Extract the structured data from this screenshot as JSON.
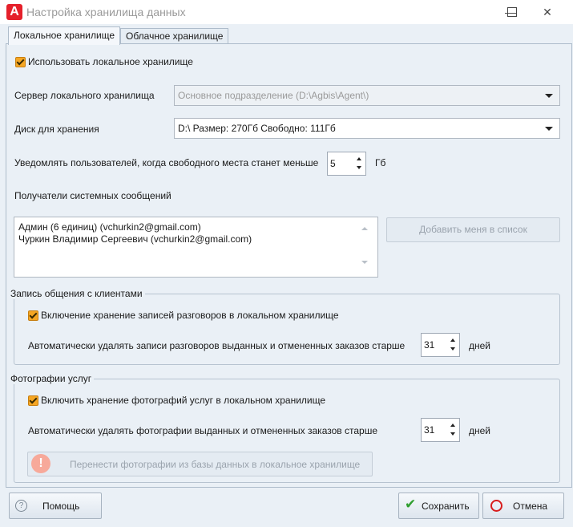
{
  "window": {
    "title": "Настройка хранилища данных",
    "logo_letter": "A",
    "minimize_symbol": "—",
    "maximize_symbol": "☐",
    "close_symbol": "✕"
  },
  "tabs": [
    {
      "label": "Локальное хранилище",
      "active": true
    },
    {
      "label": "Облачное хранилище",
      "active": false
    }
  ],
  "local": {
    "use_local_label": "Использовать локальное хранилище",
    "use_local_checked": true,
    "server_label": "Сервер локального хранилища",
    "server_value": "Основное подразделение (D:\\Agbis\\Agent\\)",
    "disk_label": "Диск для хранения",
    "disk_value": "D:\\ Размер: 270Гб Свободно: 111Гб",
    "notify_label": "Уведомлять пользователей, когда свободного места станет меньше",
    "notify_value": "5",
    "notify_unit": "Гб",
    "recipients_label": "Получатели системных сообщений",
    "recipients": [
      "Админ (6 единиц) (vchurkin2@gmail.com)",
      "Чуркин Владимир Сергеевич (vchurkin2@gmail.com)"
    ],
    "add_me_button": "Добавить меня в список"
  },
  "calls_group": {
    "title": "Запись общения с клиентами",
    "enable_label": "Включение хранение записей разговоров в локальном хранилище",
    "enable_checked": true,
    "delete_label": "Автоматически удалять записи разговоров выданных и отмененных заказов старше",
    "delete_value": "31",
    "delete_unit": "дней"
  },
  "photos_group": {
    "title": "Фотографии услуг",
    "enable_label": "Включить хранение фотографий услуг в локальном хранилище",
    "enable_checked": true,
    "delete_label": "Автоматически удалять фотографии выданных и отмененных заказов старше",
    "delete_value": "31",
    "delete_unit": "дней",
    "move_button": "Перенести фотографии из базы данных в локальное хранилище"
  },
  "footer": {
    "help_button": "Помощь",
    "save_button": "Сохранить",
    "cancel_button": "Отмена"
  },
  "colors": {
    "accent_checkbox": "#f5a623",
    "logo": "#e5202b",
    "save_check": "#2e9e2e",
    "cancel_icon": "#d81e1e",
    "warning_icon": "#f7a99a"
  }
}
